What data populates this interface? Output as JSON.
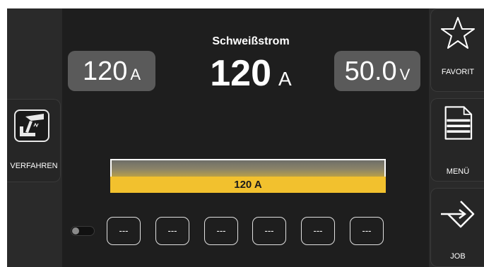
{
  "center": {
    "title": "Schweißstrom",
    "main_value": "120",
    "main_unit": "A",
    "left_param": {
      "value": "120",
      "unit": "A"
    },
    "right_param": {
      "value": "50.0",
      "unit": "V"
    },
    "bar": {
      "label": "120 A",
      "fill_fraction": 1.0,
      "fill_color": "#f2c12e"
    }
  },
  "left_panel": {
    "process_button": {
      "label": "VERFAHREN",
      "icon": "welding-torch-icon"
    }
  },
  "right_panel": {
    "favorite_button": {
      "label": "FAVORIT",
      "icon": "star-icon"
    },
    "menu_button": {
      "label": "MENÜ",
      "icon": "menu-document-icon"
    },
    "job_button": {
      "label": "JOB",
      "icon": "job-arrows-icon"
    }
  },
  "job_slots": [
    "---",
    "---",
    "---",
    "---",
    "---",
    "---"
  ],
  "toggle": {
    "state": "off"
  }
}
